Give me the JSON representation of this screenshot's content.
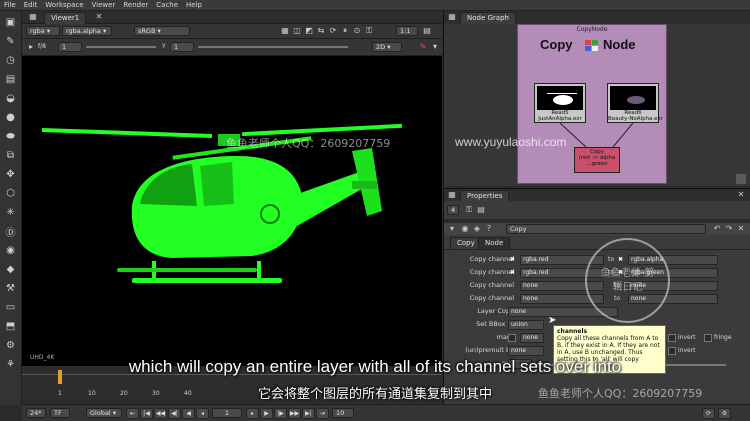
{
  "menu": [
    "File",
    "Edit",
    "Workspace",
    "Viewer",
    "Render",
    "Cache",
    "Help"
  ],
  "viewer": {
    "tab_label": "Viewer1",
    "channels": "rgba",
    "alpha": "rgba.alpha",
    "colorspace": "sRGB",
    "zoom": "1:1",
    "fstop": "f/8",
    "frame_field": "1",
    "view_mode": "2D",
    "y_field": "Y",
    "y_value": "1",
    "format_label": "UHD_4K"
  },
  "timeline": {
    "ticks": [
      "1",
      "10",
      "20",
      "30",
      "40"
    ],
    "fps": "24*",
    "tf": "TF",
    "global": "Global",
    "current_frame": "1",
    "end_frame": "10"
  },
  "nodegraph": {
    "tab_label": "Node Graph",
    "backdrop_label": "CopyNode",
    "backdrop_title_left": "Copy",
    "backdrop_title_right": "Node",
    "read5": "Read5\nJustAnAlpha.exr",
    "read6": "Read6\nBeauty-NoAlpha.exr",
    "copy_node": "Copy\n(red -> alpha\n...green"
  },
  "properties": {
    "tab_label": "Properties",
    "num_field": "4",
    "node_name": "Copy",
    "subtabs": [
      "Copy",
      "Node"
    ],
    "rows": [
      {
        "label": "Copy channel",
        "from": "rgba.red",
        "to": "rgba.alpha"
      },
      {
        "label": "Copy channel",
        "from": "rgba.red",
        "to": "rgba.green"
      },
      {
        "label": "Copy channel",
        "from": "none",
        "to": "none"
      },
      {
        "label": "Copy channel",
        "from": "none",
        "to": "none"
      }
    ],
    "to_label": "to",
    "layer_copy_label": "Layer Copy",
    "layer_copy_value": "none",
    "set_bbox_label": "Set BBox to",
    "set_bbox_value": "union",
    "mask_label": "mask",
    "mask_value": "none",
    "unpremult_label": "(un)premult by",
    "unpremult_value": "none",
    "invert_label": "invert",
    "fringe_label": "fringe",
    "mix_label": "mix",
    "mix_value": "1"
  },
  "tooltip": {
    "title": "channels",
    "body": "Copy all these channels from A to B, if they exist in A. If they are not in A, use B unchanged. Thus setting this to 'all' will copy"
  },
  "subtitles": {
    "english": "which will copy an entire layer with all of its channel sets over into",
    "chinese": "它会将整个图层的所有通道集复制到其中"
  },
  "watermarks": {
    "qq_1": "鱼鱼老师个人QQ：2609207759",
    "site": "www.yuyulaoshi.com",
    "qq_2": "鱼鱼老师个人QQ：2609207759",
    "stamp": "鱼鱼老师 剪辑日记"
  },
  "colors": {
    "helicopter": "#22ff22",
    "backdrop": "#b48cb8",
    "tooltip_bg": "#ffffcc"
  }
}
